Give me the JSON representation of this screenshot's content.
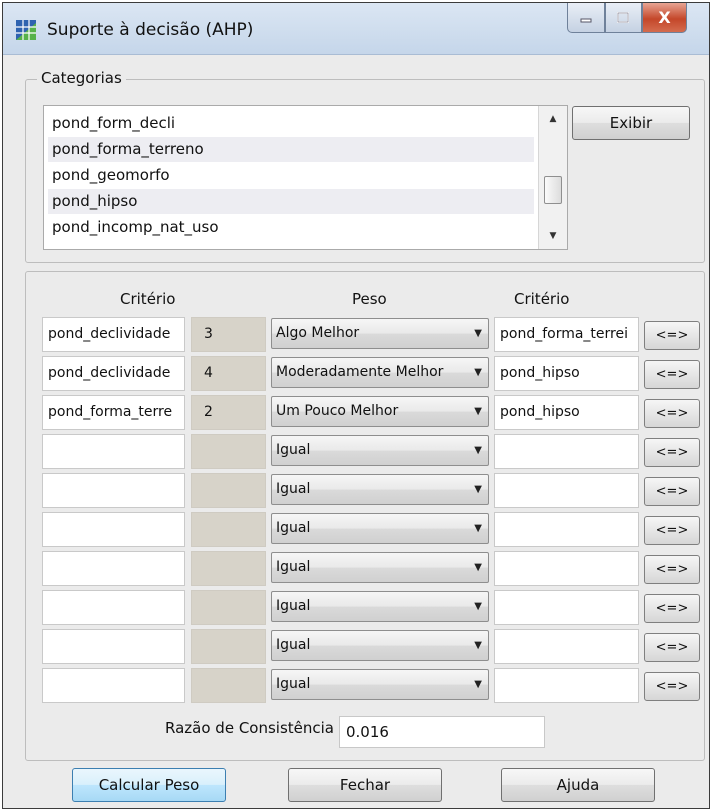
{
  "window": {
    "title": "Suporte à decisão (AHP)",
    "close_glyph": "X"
  },
  "categories": {
    "legend": "Categorias",
    "items": [
      "pond_form_decli",
      "pond_forma_terreno",
      "pond_geomorfo",
      "pond_hipso",
      "pond_incomp_nat_uso"
    ],
    "show_button": "Exibir"
  },
  "comparison": {
    "headers": {
      "criterion_left": "Critério",
      "weight": "Peso",
      "criterion_right": "Critério"
    },
    "swap_label": "<=>",
    "rows": [
      {
        "left": "pond_declividade",
        "value": "3",
        "weight": "Algo Melhor",
        "right": "pond_forma_terrei"
      },
      {
        "left": "pond_declividade",
        "value": "4",
        "weight": "Moderadamente Melhor",
        "right": "pond_hipso"
      },
      {
        "left": "pond_forma_terre",
        "value": "2",
        "weight": "Um Pouco Melhor",
        "right": "pond_hipso"
      },
      {
        "left": "",
        "value": "",
        "weight": "Igual",
        "right": ""
      },
      {
        "left": "",
        "value": "",
        "weight": "Igual",
        "right": ""
      },
      {
        "left": "",
        "value": "",
        "weight": "Igual",
        "right": ""
      },
      {
        "left": "",
        "value": "",
        "weight": "Igual",
        "right": ""
      },
      {
        "left": "",
        "value": "",
        "weight": "Igual",
        "right": ""
      },
      {
        "left": "",
        "value": "",
        "weight": "Igual",
        "right": ""
      },
      {
        "left": "",
        "value": "",
        "weight": "Igual",
        "right": ""
      }
    ]
  },
  "consistency": {
    "label": "Razão de Consistência",
    "value": "0.016"
  },
  "footer": {
    "calculate": "Calcular Peso",
    "close": "Fechar",
    "help": "Ajuda"
  }
}
